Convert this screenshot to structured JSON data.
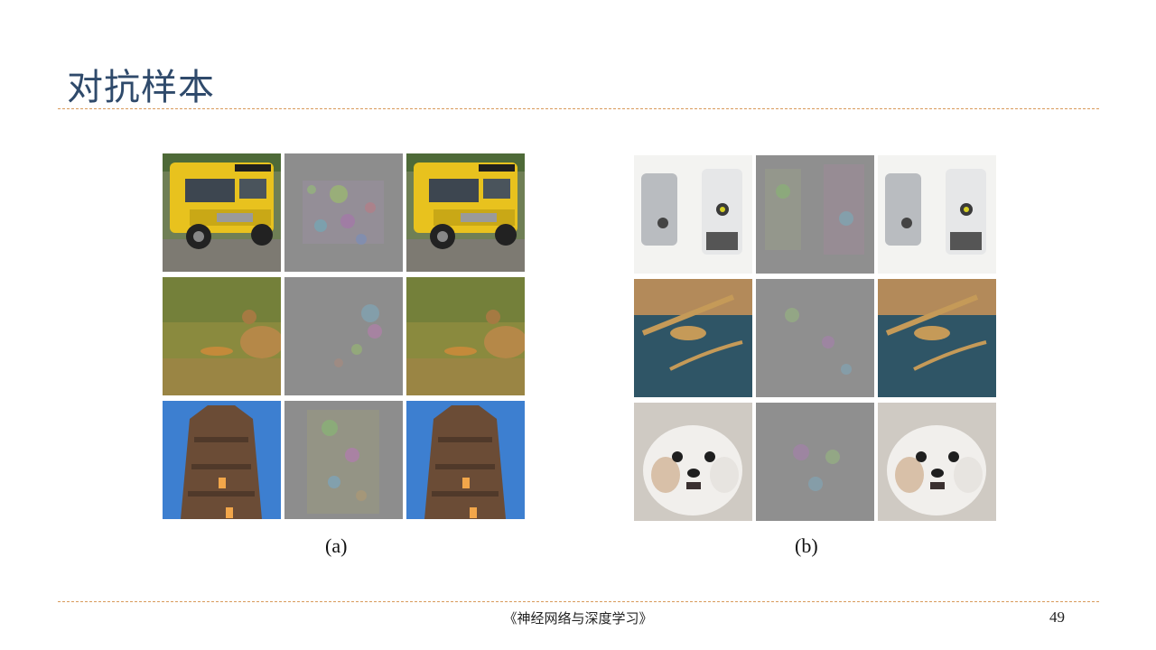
{
  "slide": {
    "title": "对抗样本",
    "footer": "《神经网络与深度学习》",
    "page_number": "49"
  },
  "figure_a": {
    "caption": "(a)",
    "rows": [
      [
        "school-bus-photo",
        "noise-perturbation",
        "school-bus-photo"
      ],
      [
        "bird-photo",
        "noise-perturbation",
        "bird-photo"
      ],
      [
        "temple-photo",
        "noise-perturbation",
        "temple-photo"
      ]
    ]
  },
  "figure_b": {
    "caption": "(b)",
    "rows": [
      [
        "soap-dispenser-photo",
        "noise-perturbation",
        "soap-dispenser-photo"
      ],
      [
        "mantis-photo",
        "noise-perturbation",
        "mantis-photo"
      ],
      [
        "dog-photo",
        "noise-perturbation",
        "dog-photo"
      ]
    ]
  },
  "colors": {
    "title": "#2f4a6b",
    "rule": "#d89a5a"
  }
}
